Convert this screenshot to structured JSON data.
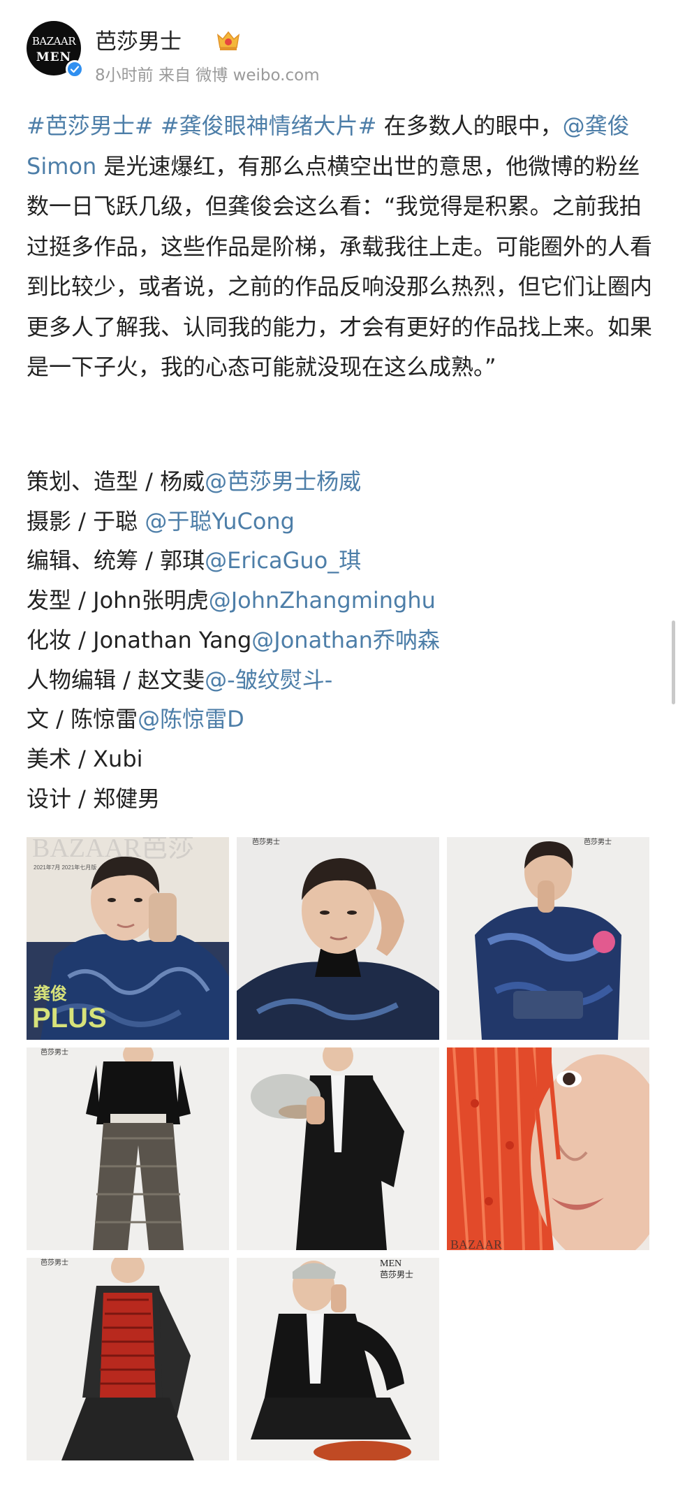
{
  "header": {
    "avatar_logo_top": "BAZAAR",
    "avatar_logo_bottom": "MEN",
    "username": "芭莎男士",
    "meta": "8小时前 来自 微博 weibo.com",
    "vip_icon": "crown-badge-icon",
    "verify_icon": "verified-check-icon"
  },
  "post": {
    "paragraph": [
      {
        "text": "#芭莎男士#",
        "link": true
      },
      {
        "text": " ",
        "link": false
      },
      {
        "text": "#龚俊眼神情绪大片#",
        "link": true
      },
      {
        "text": " 在多数人的眼中，",
        "link": false
      },
      {
        "text": "@龚俊Simon",
        "link": true
      },
      {
        "text": " 是光速爆红，有那么点横空出世的意思，他微博的粉丝数一日飞跃几级，但龚俊会这么看：“我觉得是积累。之前我拍过挺多作品，这些作品是阶梯，承载我往上走。可能圈外的人看到比较少，或者说，之前的作品反响没那么热烈，但它们让圈内更多人了解我、认同我的能力，才会有更好的作品找上来。如果是一下子火，我的心态可能就没现在这么成熟。”",
        "link": false
      }
    ]
  },
  "credits": [
    {
      "role": "策划、造型 / 杨威",
      "mention": "@芭莎男士杨威"
    },
    {
      "role": "摄影 / 于聪 ",
      "mention": "@于聪YuCong"
    },
    {
      "role": "编辑、统筹 / 郭琪",
      "mention": "@EricaGuo_琪"
    },
    {
      "role": "发型 / John张明虎",
      "mention": "@JohnZhangminghu"
    },
    {
      "role": "化妆 / Jonathan Yang",
      "mention": "@Jonathan乔呐森"
    },
    {
      "role": "人物编辑 / 赵文斐",
      "mention": "@-皱纹熨斗-"
    },
    {
      "role": "文 / 陈惊雷",
      "mention": "@陈惊雷D"
    },
    {
      "role": "美术 / Xubi",
      "mention": ""
    },
    {
      "role": "设计 / 郑健男",
      "mention": ""
    }
  ],
  "images": {
    "cover_masthead": "BAZAAR芭莎",
    "cover_small_text": "2021年7月 2021年七月版",
    "cover_name": "龚俊",
    "cover_plus": "PLUS",
    "corner_logo": "芭莎男士",
    "corner_logo_men": "MEN",
    "bazaar_footer": "BAZAAR",
    "items": [
      {
        "name": "magazine-cover-photo"
      },
      {
        "name": "hand-on-temple-portrait-photo"
      },
      {
        "name": "blue-jacket-pose-photo"
      },
      {
        "name": "black-blazer-tweed-trousers-photo"
      },
      {
        "name": "suit-holding-cap-photo"
      },
      {
        "name": "red-fringe-closeup-photo"
      },
      {
        "name": "red-knit-vest-photo"
      },
      {
        "name": "seated-black-suit-photo"
      }
    ]
  }
}
